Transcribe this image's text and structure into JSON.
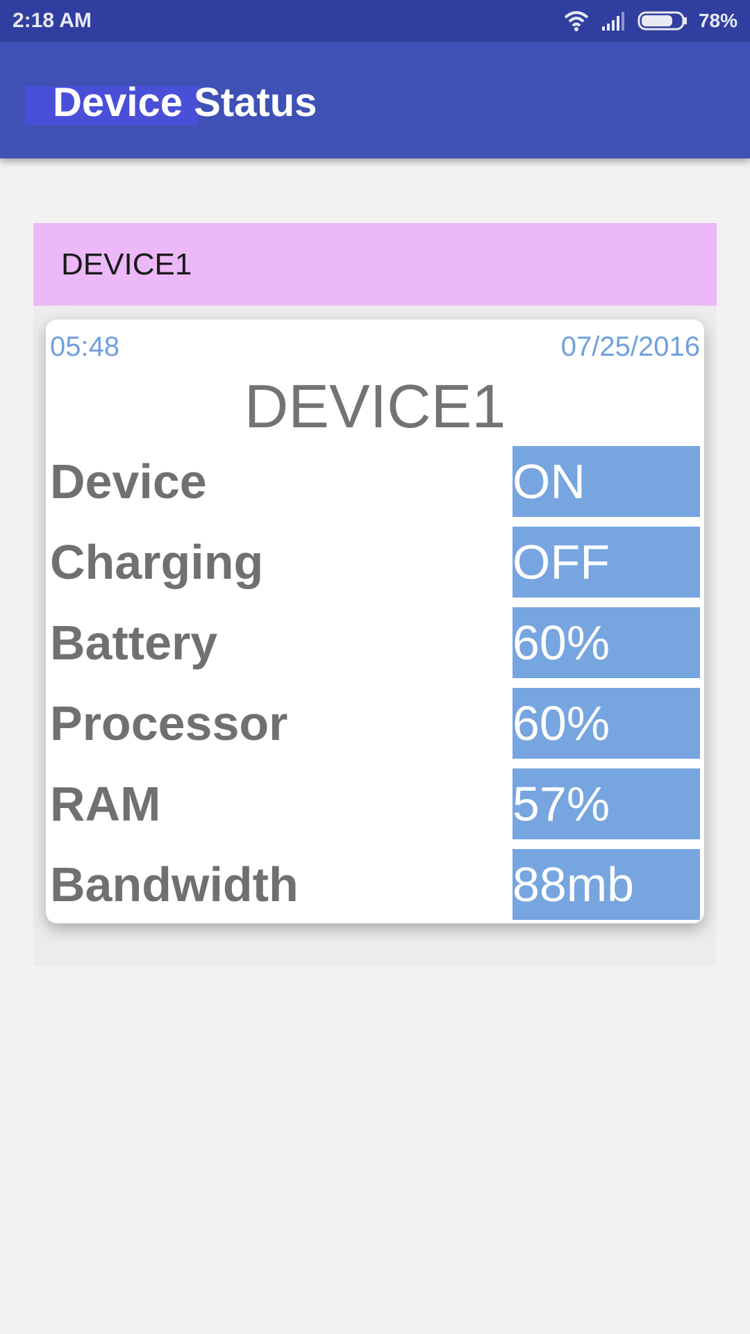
{
  "status_bar": {
    "time": "2:18 AM",
    "battery_percent": "78%",
    "icons": [
      "wifi-icon",
      "signal-icon",
      "battery-icon"
    ],
    "battery_level": 0.78
  },
  "app_bar": {
    "title": "Device Status",
    "color": "#3f51b5"
  },
  "device_group": {
    "header_label": "DEVICE1",
    "header_color": "#ecb8f7"
  },
  "card": {
    "time": "05:48",
    "date": "07/25/2016",
    "title": "DEVICE1",
    "value_color": "#76a5e0",
    "rows": [
      {
        "label": "Device",
        "value": "ON"
      },
      {
        "label": "Charging",
        "value": "OFF"
      },
      {
        "label": "Battery",
        "value": "60%"
      },
      {
        "label": "Processor",
        "value": "60%"
      },
      {
        "label": "RAM",
        "value": "57%"
      },
      {
        "label": "Bandwidth",
        "value": "88mb"
      }
    ]
  }
}
